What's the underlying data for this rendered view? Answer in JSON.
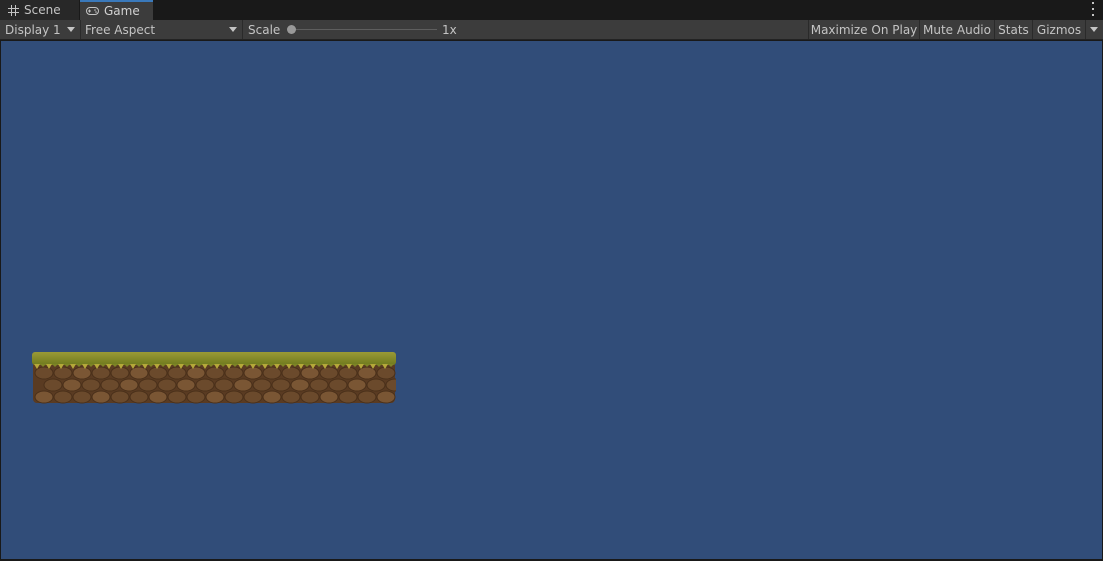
{
  "tabs": [
    {
      "label": "Scene",
      "icon": "grid-icon",
      "active": false
    },
    {
      "label": "Game",
      "icon": "gamepad-icon",
      "active": true
    }
  ],
  "toolbar": {
    "display": "Display 1",
    "aspect": "Free Aspect",
    "scale_label": "Scale",
    "scale_value": "1x",
    "scale_slider_fraction": 0.0,
    "maximize_on_play": "Maximize On Play",
    "mute_audio": "Mute Audio",
    "stats": "Stats",
    "gizmos": "Gizmos"
  },
  "colors": {
    "tab_accent": "#3a79bb",
    "toolbar_bg": "#3c3c3c",
    "game_background": "#314d79",
    "grass": "#8a8a2a",
    "dirt": "#6b4a2c"
  },
  "game": {
    "objects": [
      {
        "type": "grass-dirt-platform"
      }
    ]
  }
}
